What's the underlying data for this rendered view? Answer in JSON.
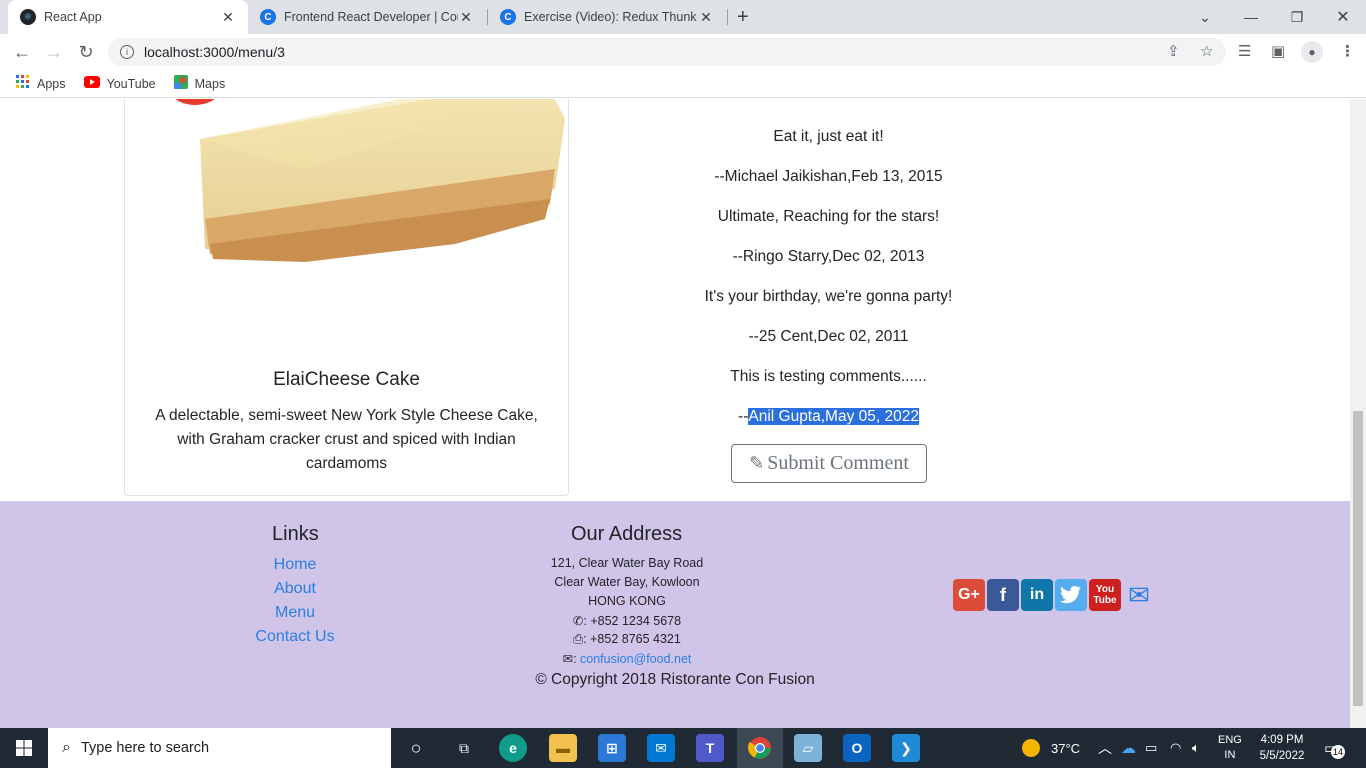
{
  "browser": {
    "tabs": [
      {
        "title": "React App",
        "active": true
      },
      {
        "title": "Frontend React Developer | Cour",
        "active": false
      },
      {
        "title": "Exercise (Video): Redux Thunk | C",
        "active": false
      }
    ],
    "url": "localhost:3000/menu/3",
    "bookmarks": [
      "Apps",
      "YouTube",
      "Maps"
    ]
  },
  "dish": {
    "name": "ElaiCheese Cake",
    "description": "A delectable, semi-sweet New York Style Cheese Cake, with Graham cracker crust and spiced with Indian cardamoms"
  },
  "comments": [
    {
      "comment": "Eat it, just eat it!",
      "author_line": "--Michael Jaikishan,Feb 13, 2015"
    },
    {
      "comment": "Ultimate, Reaching for the stars!",
      "author_line": "--Ringo Starry,Dec 02, 2013"
    },
    {
      "comment": "It's your birthday, we're gonna party!",
      "author_line": "--25 Cent,Dec 02, 2011"
    },
    {
      "comment": "This is testing comments......",
      "author_prefix": "--",
      "author_selected": "Anil Gupta,May 05, 2022"
    }
  ],
  "submit_comment_label": "Submit Comment",
  "footer": {
    "links_heading": "Links",
    "links": [
      "Home",
      "About",
      "Menu",
      "Contact Us"
    ],
    "address_heading": "Our Address",
    "address_lines": [
      "121, Clear Water Bay Road",
      "Clear Water Bay, Kowloon",
      "HONG KONG"
    ],
    "phone": ": +852 1234 5678",
    "fax": ": +852 8765 4321",
    "email_prefix": ": ",
    "email": "confusion@food.net",
    "copyright": "© Copyright 2018 Ristorante Con Fusion",
    "social": [
      "google-plus",
      "facebook",
      "linkedin",
      "twitter",
      "youtube",
      "mail"
    ]
  },
  "taskbar": {
    "search_placeholder": "Type here to search",
    "weather": "37°C",
    "lang_top": "ENG",
    "lang_bottom": "IN",
    "time": "4:09 PM",
    "date": "5/5/2022",
    "notifications": "14"
  },
  "colors": {
    "footer_bg": "#d1c4e9",
    "link": "#2a7ee7",
    "selection": "#2b6ede"
  }
}
